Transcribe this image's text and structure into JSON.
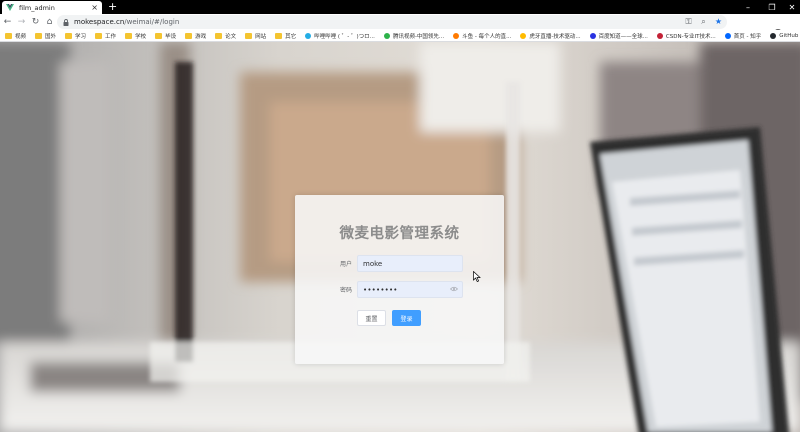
{
  "browser": {
    "tab_title": "film_admin",
    "new_tab_symbol": "+",
    "url_host": "mokespace.cn",
    "url_path": "/weimai/#/login"
  },
  "bookmarks": [
    {
      "label": "视频",
      "icon": "folder"
    },
    {
      "label": "国外",
      "icon": "folder"
    },
    {
      "label": "学习",
      "icon": "folder"
    },
    {
      "label": "工作",
      "icon": "folder"
    },
    {
      "label": "学校",
      "icon": "folder"
    },
    {
      "label": "毕设",
      "icon": "folder"
    },
    {
      "label": "游戏",
      "icon": "folder"
    },
    {
      "label": "论文",
      "icon": "folder"
    },
    {
      "label": "网站",
      "icon": "folder"
    },
    {
      "label": "其它",
      "icon": "folder"
    },
    {
      "label": "哔哩哔哩 ( ゜- ゜)つロ...",
      "icon": "bilibili",
      "color": "#23ade5"
    },
    {
      "label": "腾讯视频-中国领先...",
      "icon": "tencent-video",
      "color": "#2db24a"
    },
    {
      "label": "斗鱼 - 每个人的直...",
      "icon": "douyu",
      "color": "#ff7a00"
    },
    {
      "label": "虎牙直播-技术驱动...",
      "icon": "huya",
      "color": "#ffbb00"
    },
    {
      "label": "百度知道——全球...",
      "icon": "baidu",
      "color": "#2932e1"
    },
    {
      "label": "CSDN-专业IT技术...",
      "icon": "csdn",
      "color": "#c32136"
    },
    {
      "label": "首页 - 知乎",
      "icon": "zhihu",
      "color": "#0066ff"
    },
    {
      "label": "GitHub",
      "icon": "github",
      "color": "#24292e"
    }
  ],
  "login": {
    "title": "微麦电影管理系统",
    "username_label": "用户",
    "username_value": "moke",
    "password_label": "密码",
    "password_value": "••••••••",
    "reset_label": "重置",
    "login_label": "登录"
  },
  "colors": {
    "primary": "#409eff",
    "title_gray": "#8c8c8c",
    "input_bg": "#e8eefb"
  }
}
